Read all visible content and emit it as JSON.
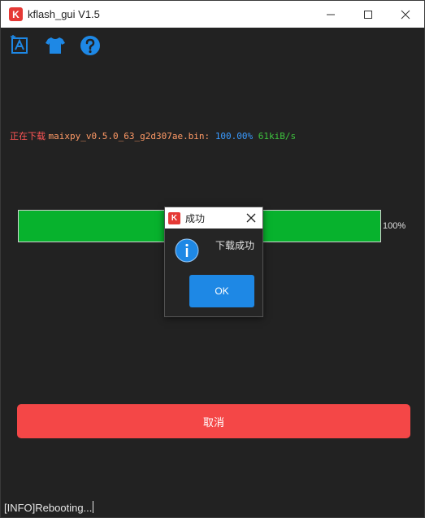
{
  "window": {
    "title": "kflash_gui V1.5",
    "logo_letter": "K"
  },
  "toolbar": {
    "icons": [
      "language-icon",
      "skin-icon",
      "help-icon"
    ]
  },
  "status": {
    "prefix": "正在下载 ",
    "file": "maixpy_v0.5.0_63_g2d307ae.bin: ",
    "percent": "100.00%",
    "speed": " 61kiB/s"
  },
  "progress": {
    "value": 1.0,
    "label": "100%"
  },
  "cancel_button": {
    "label": "取消"
  },
  "log": {
    "text": "[INFO]Rebooting..."
  },
  "dialog": {
    "title": "成功",
    "message": "下载成功",
    "ok_label": "OK",
    "logo_letter": "K"
  },
  "colors": {
    "status_prefix": "#ff5555",
    "status_file": "#ff9a66",
    "status_percent": "#3a9bff",
    "status_speed": "#3ec43e",
    "progress_fill": "#07b22d",
    "cancel": "#f44747",
    "ok": "#1e88e5",
    "accent_icon": "#1e88e5"
  }
}
